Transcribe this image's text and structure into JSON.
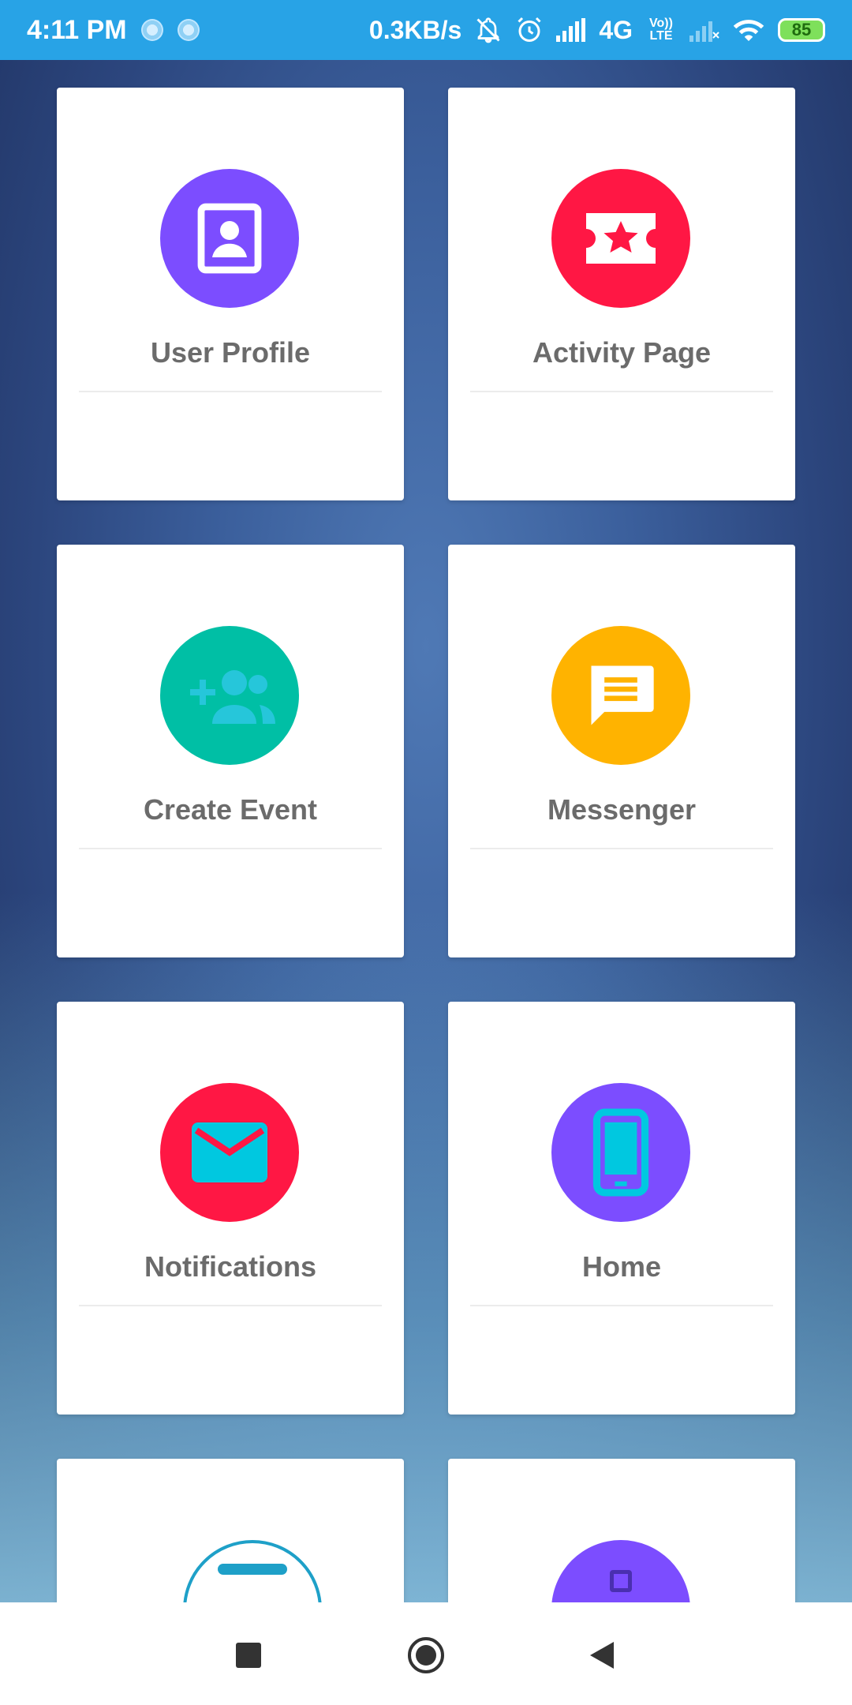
{
  "status_bar": {
    "time": "4:11 PM",
    "speed": "0.3KB/s",
    "network": "4G",
    "volte": "Vo)) LTE",
    "battery": "85",
    "icons": [
      "spinner-icon",
      "spinner-icon",
      "notifications-off-icon",
      "alarm-icon",
      "signal-icon",
      "signal-empty-icon",
      "wifi-icon",
      "battery-icon"
    ]
  },
  "menu": {
    "items": [
      {
        "label": "User Profile",
        "icon": "contact-card-icon",
        "color": "#7c4dff"
      },
      {
        "label": "Activity Page",
        "icon": "ticket-star-icon",
        "color": "#ff1744"
      },
      {
        "label": "Create Event",
        "icon": "group-add-icon",
        "color": "#00bfa5"
      },
      {
        "label": "Messenger",
        "icon": "message-icon",
        "color": "#ffb300"
      },
      {
        "label": "Notifications",
        "icon": "mail-icon",
        "color": "#ff1744"
      },
      {
        "label": "Home",
        "icon": "phone-icon",
        "color": "#7c4dff"
      },
      {
        "label": "",
        "icon": "settings-icon",
        "color": "#1ea0c8"
      },
      {
        "label": "",
        "icon": "device-icon",
        "color": "#7c4dff"
      }
    ]
  },
  "nav_bar": {
    "buttons": [
      "recents-button",
      "home-button",
      "back-button"
    ]
  }
}
